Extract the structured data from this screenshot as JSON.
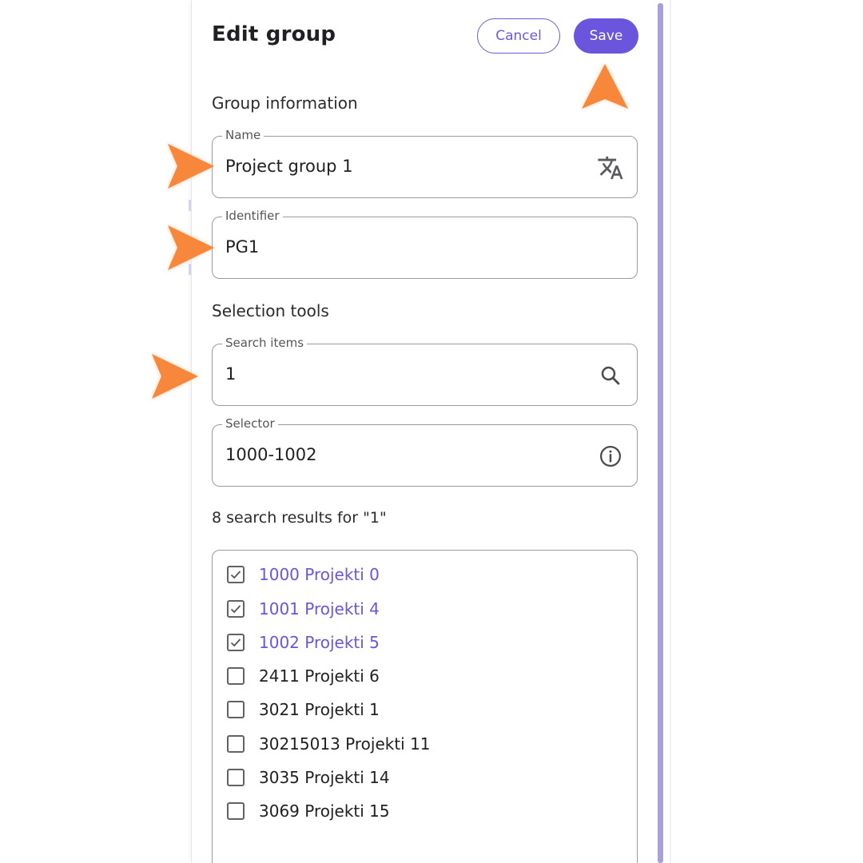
{
  "header": {
    "title": "Edit group",
    "cancel_label": "Cancel",
    "save_label": "Save"
  },
  "group_information": {
    "section_title": "Group information",
    "name": {
      "label": "Name",
      "value": "Project group 1",
      "icon": "translate-icon"
    },
    "identifier": {
      "label": "Identifier",
      "value": "PG1"
    }
  },
  "selection_tools": {
    "section_title": "Selection tools",
    "search": {
      "label": "Search items",
      "value": "1",
      "icon": "search-icon"
    },
    "selector": {
      "label": "Selector",
      "value": "1000-1002",
      "icon": "info-icon"
    }
  },
  "results": {
    "summary": "8 search results for \"1\"",
    "items": [
      {
        "label": "1000 Projekti 0",
        "checked": true
      },
      {
        "label": "1001 Projekti 4",
        "checked": true
      },
      {
        "label": "1002 Projekti 5",
        "checked": true
      },
      {
        "label": "2411 Projekti 6",
        "checked": false
      },
      {
        "label": "3021 Projekti 1",
        "checked": false
      },
      {
        "label": "30215013 Projekti 11",
        "checked": false
      },
      {
        "label": "3035 Projekti 14",
        "checked": false
      },
      {
        "label": "3069 Projekti 15",
        "checked": false
      }
    ]
  },
  "colors": {
    "accent": "#6a55dc",
    "callout_arrow": "#f7873a",
    "scrollbar": "#a89fdc"
  }
}
